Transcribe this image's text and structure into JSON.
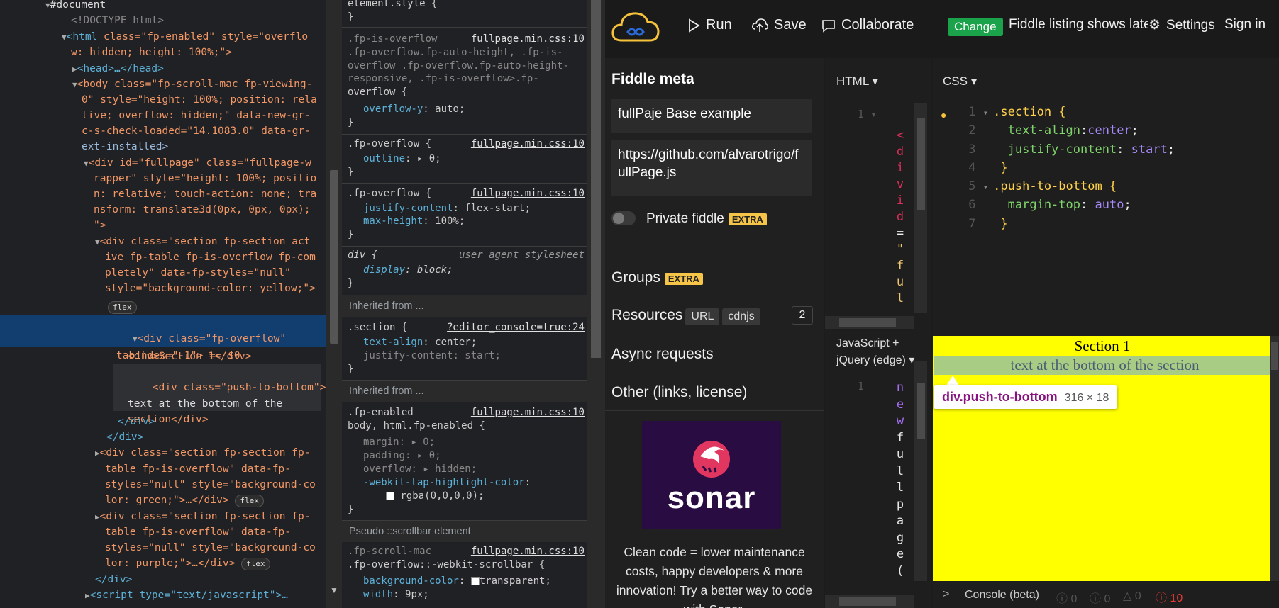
{
  "dom": {
    "lines": [
      {
        "t": "document",
        "text": "#document"
      },
      {
        "t": "doctype",
        "text": "<!DOCTYPE html>"
      },
      {
        "t": "html1",
        "tag": "<html",
        "attrs": " class=\"fp-enabled\" style=\"overflo"
      },
      {
        "t": "html2",
        "text": "w: hidden; height: 100%;\">"
      },
      {
        "t": "head",
        "text": "<head>…</head>"
      },
      {
        "t": "body1",
        "text": "<body class=\"fp-scroll-mac fp-viewing-"
      },
      {
        "t": "body2",
        "text": "0\" style=\"height: 100%; position: rela"
      },
      {
        "t": "body3",
        "text": "tive; overflow: hidden;\" data-new-gr-"
      },
      {
        "t": "body4",
        "text": "c-s-check-loaded=\"14.1083.0\" data-gr-"
      },
      {
        "t": "body5",
        "text": "ext-installed>"
      },
      {
        "t": "fp1",
        "text": "<div id=\"fullpage\" class=\"fullpage-w"
      },
      {
        "t": "fp2",
        "text": "rapper\" style=\"height: 100%; positio"
      },
      {
        "t": "fp3",
        "text": "n: relative; touch-action: none; tra"
      },
      {
        "t": "fp4",
        "text": "nsform: translate3d(0px, 0px, 0px);"
      },
      {
        "t": "fp5",
        "text": "\">"
      },
      {
        "t": "s1a",
        "text": "<div class=\"section fp-section act"
      },
      {
        "t": "s1b",
        "text": "ive fp-table fp-is-overflow fp-com"
      },
      {
        "t": "s1c",
        "text": "pletely\" data-fp-styles=\"null\""
      },
      {
        "t": "s1d",
        "text": "style=\"background-color: yellow;\">"
      },
      {
        "t": "flex1",
        "text": "flex"
      },
      {
        "t": "ov1",
        "text": "<div class=\"fp-overflow\""
      },
      {
        "t": "ov2",
        "text": "tabindex=\"-1\"> == $0"
      },
      {
        "t": "sec",
        "text": "<div>Section 1</div>"
      },
      {
        "t": "ptb1",
        "text": "<div class=\"push-to-bottom\">"
      },
      {
        "t": "ptb2",
        "text": "text at the bottom of the"
      },
      {
        "t": "ptb3",
        "text": "section</div>"
      },
      {
        "t": "c1",
        "text": "</div>"
      },
      {
        "t": "c2",
        "text": "</div>"
      },
      {
        "t": "s2a",
        "text": "<div class=\"section fp-section fp-"
      },
      {
        "t": "s2b",
        "text": "table fp-is-overflow\" data-fp-"
      },
      {
        "t": "s2c",
        "text": "styles=\"null\" style=\"background-co"
      },
      {
        "t": "s2d",
        "text": "lor: green;\">…</div>"
      },
      {
        "t": "s3a",
        "text": "<div class=\"section fp-section fp-"
      },
      {
        "t": "s3b",
        "text": "table fp-is-overflow\" data-fp-"
      },
      {
        "t": "s3c",
        "text": "styles=\"null\" style=\"background-co"
      },
      {
        "t": "s3d",
        "text": "lor: purple;\">…</div>"
      },
      {
        "t": "c3",
        "text": "</div>"
      },
      {
        "t": "script",
        "text": "<script type=\"text/javascript\">…"
      }
    ],
    "flex_badge": "flex"
  },
  "styles": {
    "element_style": "element.style {",
    "close": "}",
    "r1_sel": ".fp-is-overflow .fp-overflow.fp-auto-height, .fp-is-overflow .fp-overflow.fp-auto-height-responsive, .fp-is-overflow>.fp-overflow {",
    "r1_sel_lines": [
      ".fp-is-overflow",
      ".fp-overflow.fp-auto-height, .fp-is-",
      "overflow .fp-overflow.fp-auto-height-",
      "responsive, .fp-is-overflow>.fp-",
      "overflow {"
    ],
    "r1_prop": "overflow-y",
    "r1_val": "auto;",
    "src": "fullpage.min.css:10",
    "r2_sel": ".fp-overflow {",
    "r2_prop": "outline",
    "r2_val": "0;",
    "r3_sel": ".fp-overflow {",
    "r3_p1": "justify-content",
    "r3_v1": "flex-start;",
    "r3_p2": "max-height",
    "r3_v2": "100%;",
    "r4_sel": "div {",
    "r4_src": "user agent stylesheet",
    "r4_prop": "display",
    "r4_val": "block;",
    "inherited": "Inherited from ...",
    "r5_sel": ".section {",
    "r5_src": "?editor_console=true:24",
    "r5_p1": "text-align",
    "r5_v1": "center;",
    "r5_p2": "justify-content",
    "r5_v2": "start;",
    "r6_sel1": ".fp-enabled",
    "r6_sel2": "body, html.fp-enabled {",
    "r6_p1": "margin",
    "r6_v1": "0;",
    "r6_p2": "padding",
    "r6_v2": "0;",
    "r6_p3": "overflow",
    "r6_v3": "hidden;",
    "r6_p4": "-webkit-tap-highlight-color",
    "r6_v4": "rgba(0,0,0,0);",
    "pseudo": "Pseudo ::scrollbar element",
    "r7_sel1": ".fp-scroll-mac",
    "r7_sel2": ".fp-overflow::-webkit-scrollbar {",
    "r7_p1": "background-color",
    "r7_v1": "transparent;",
    "r7_p2": "width",
    "r7_v2": "9px;"
  },
  "app": {
    "run": "Run",
    "save": "Save",
    "collaborate": "Collaborate",
    "change": "Change",
    "notice": "Fiddle listing shows latest version",
    "settings": "Settings",
    "signin": "Sign in",
    "meta_title": "Fiddle meta",
    "title_value": "fullPaje Base example",
    "url_value": "https://github.com/alvarotrigo/fullPage.js",
    "private": "Private fiddle",
    "extra": "EXTRA",
    "groups": "Groups",
    "resources": "Resources",
    "url_pill": "URL",
    "cdnjs_pill": "cdnjs",
    "res_count": "2",
    "async": "Async requests",
    "other": "Other (links, license)",
    "ad_brand": "sonar",
    "ad_text": "Clean code = lower maintenance costs, happy developers & more innovation! Try a better way to code with Sonar.",
    "html_label": "HTML",
    "css_label": "CSS",
    "js_label": "JavaScript + jQuery (edge)",
    "html_code_chars": [
      "<",
      "d",
      "i",
      "v",
      "i",
      "d",
      "=",
      "\"",
      "f",
      "u",
      "l"
    ],
    "js_code_chars": [
      "n",
      "e",
      "w",
      "f",
      "u",
      "l",
      "l",
      "p",
      "a",
      "g",
      "e",
      "("
    ],
    "css_lines": [
      {
        "n": "1",
        "text": ".section {"
      },
      {
        "n": "2",
        "prop": "text-align",
        "val": "center;"
      },
      {
        "n": "3",
        "prop": "justify-content",
        "val": "start;"
      },
      {
        "n": "4",
        "text": "}"
      },
      {
        "n": "5",
        "text": ".push-to-bottom {"
      },
      {
        "n": "6",
        "prop": "margin-top",
        "val": "auto;"
      },
      {
        "n": "7",
        "text": "}"
      }
    ],
    "result_title": "Section 1",
    "result_bottom": "text at the bottom of the section",
    "tooltip_sel": "div.push-to-bottom",
    "tooltip_dim": "316 × 18",
    "console": "Console (beta)",
    "c_info": "0",
    "c_warn": "0",
    "c_log": "0",
    "c_err": "10"
  },
  "colors": {
    "accent_green": "#1aa34a",
    "result_bg": "#ffff00",
    "extra": "#f6c548",
    "selection": "#113d6f"
  }
}
